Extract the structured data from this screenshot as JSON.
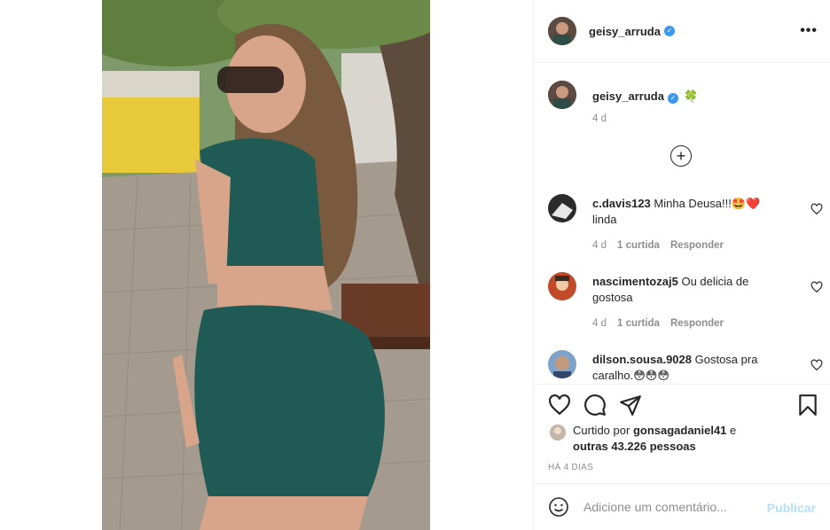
{
  "post": {
    "author": "geisy_arruda",
    "caption_emoji": "🍀",
    "caption_time": "4 d",
    "more_label": "•••"
  },
  "comments": [
    {
      "user": "c.davis123",
      "text": "Minha Deusa!!!🤩❤️ linda",
      "time": "4 d",
      "likes": "1 curtida",
      "reply": "Responder"
    },
    {
      "user": "nascimentozaj5",
      "text": "Ou delicia de gostosa",
      "time": "4 d",
      "likes": "1 curtida",
      "reply": "Responder"
    },
    {
      "user": "dilson.sousa.9028",
      "text": "Gostosa pra caralho.😳😳😳"
    }
  ],
  "likes": {
    "prefix": "Curtido por",
    "user": "gonsagadaniel41",
    "connector": "e",
    "others": "outras 43.226 pessoas"
  },
  "posted_ago": "HÁ 4 DIAS",
  "add_comment": {
    "placeholder": "Adicione um comentário...",
    "publish_label": "Publicar"
  },
  "colors": {
    "verified": "#3897f0",
    "publish_disabled": "#b2dffc",
    "meta": "#8e8e8e"
  },
  "icons": [
    "verified-badge-icon",
    "more-options-icon",
    "plus-circle-icon",
    "heart-icon",
    "comment-icon",
    "share-icon",
    "bookmark-icon",
    "emoji-icon"
  ]
}
